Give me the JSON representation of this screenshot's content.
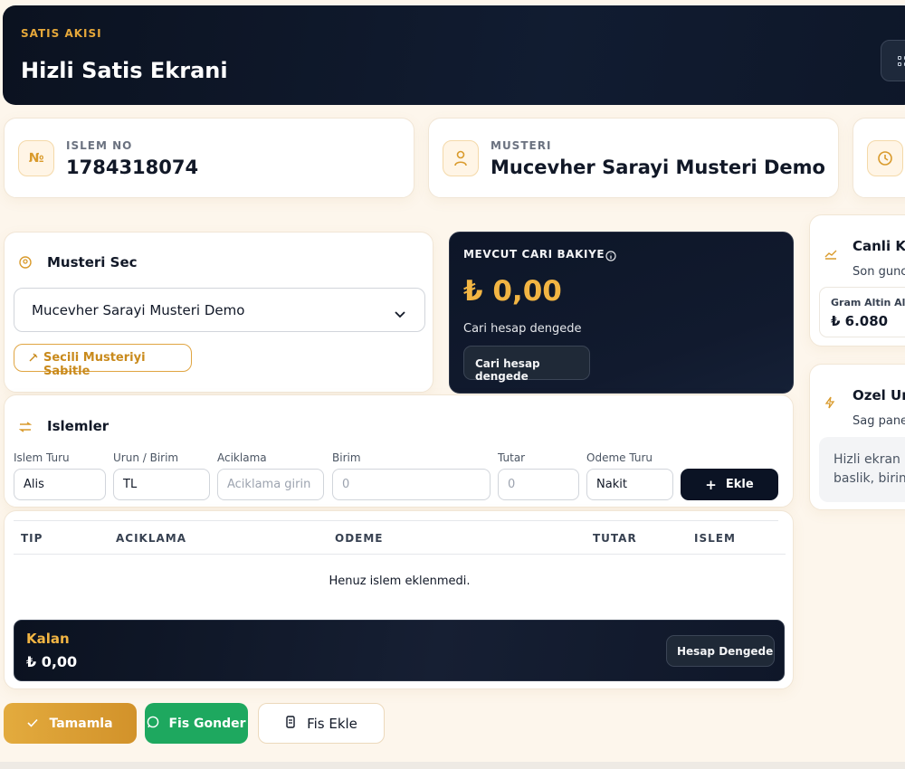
{
  "header": {
    "kicker": "SATIS AKISI",
    "title": "Hizli Satis Ekrani"
  },
  "info_cards": {
    "transaction": {
      "icon": "№",
      "label": "ISLEM NO",
      "value": "1784318074"
    },
    "customer": {
      "label": "MUSTERI",
      "value": "Mucevher Sarayi Musteri Demo"
    }
  },
  "customer_select": {
    "title": "Musteri Sec",
    "selected": "Mucevher Sarayi Musteri Demo",
    "pin_label": "Secili Musteriyi Sabitle"
  },
  "balance": {
    "label": "MEVCUT CARI BAKIYE",
    "amount": "₺ 0,00",
    "status": "Cari hesap dengede",
    "badge": "Cari hesap dengede",
    "accent": "#f2b543"
  },
  "live_rates": {
    "title": "Canli Ku",
    "subtitle": "Son gunc",
    "item_label": "Gram Altin Alis",
    "item_value": "₺ 6.080"
  },
  "special_product": {
    "title": "Ozel Uru",
    "subtitle": "Sag pane",
    "note_line1": "Hizli ekran i",
    "note_line2": "baslik, birim"
  },
  "transactions": {
    "title": "Islemler",
    "fields": {
      "type": {
        "label": "Islem Turu",
        "value": "Alis"
      },
      "unit": {
        "label": "Urun / Birim",
        "value": "TL"
      },
      "description": {
        "label": "Aciklama",
        "placeholder": "Aciklama girin"
      },
      "amount_unit": {
        "label": "Birim",
        "placeholder": "0"
      },
      "total": {
        "label": "Tutar",
        "placeholder": "0"
      },
      "payment": {
        "label": "Odeme Turu",
        "value": "Nakit"
      }
    },
    "add_label": "Ekle"
  },
  "table": {
    "columns": [
      "TIP",
      "ACIKLAMA",
      "ODEME",
      "TUTAR",
      "ISLEM"
    ],
    "empty_text": "Henuz islem eklenmedi."
  },
  "remaining": {
    "label": "Kalan",
    "amount": "₺ 0,00",
    "badge": "Hesap Dengede"
  },
  "actions": {
    "complete": "Tamamla",
    "send": "Fis Gonder",
    "add_receipt": "Fis Ekle"
  }
}
